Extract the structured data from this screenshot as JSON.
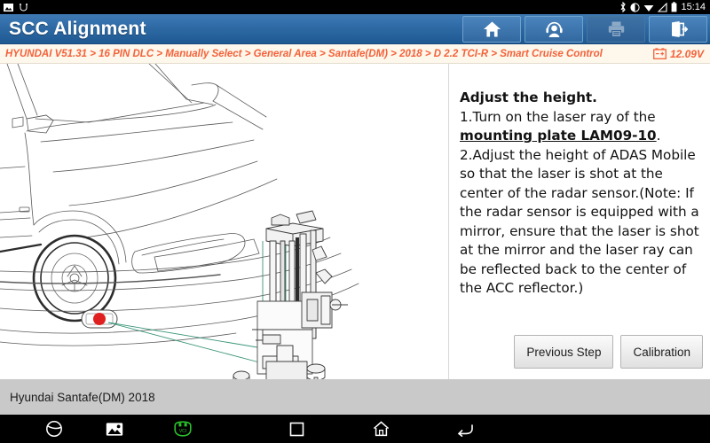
{
  "status_bar": {
    "clock": "15:14",
    "left_icons": [
      "screenshot-icon",
      "usb-debug-icon"
    ],
    "right_icons": [
      "bluetooth-icon",
      "do-not-disturb-icon",
      "wifi-icon",
      "signal-icon",
      "battery-icon"
    ]
  },
  "title_bar": {
    "title": "SCC Alignment",
    "buttons": [
      {
        "name": "home-button",
        "icon": "home-icon",
        "label": "Home",
        "enabled": true
      },
      {
        "name": "support-button",
        "icon": "headset-icon",
        "label": "Support",
        "enabled": true
      },
      {
        "name": "print-button",
        "icon": "printer-icon",
        "label": "Print",
        "enabled": false
      },
      {
        "name": "exit-button",
        "icon": "exit-icon",
        "label": "Exit",
        "enabled": true
      }
    ]
  },
  "path_bar": {
    "breadcrumb": "HYUNDAI V51.31 > 16 PIN DLC > Manually Select > General Area > Santafe(DM) > 2018 > D 2.2 TCI-R > Smart Cruise Control",
    "segments": [
      "HYUNDAI V51.31",
      "16 PIN DLC",
      "Manually Select",
      "General Area",
      "Santafe(DM)",
      "2018",
      "D 2.2 TCI-R",
      "Smart Cruise Control"
    ],
    "battery_icon": "car-battery-icon",
    "voltage": "12.09V"
  },
  "main": {
    "illustration": {
      "name": "adas-calibration-diagram",
      "description": "Line drawing of a vehicle front end with an ADAS Mobile calibration frame and laser aimed at the radar sensor",
      "radar_sensor_marker_color": "#e02020",
      "laser_ray_color": "#2f8f72"
    },
    "instruction": {
      "heading": "Adjust the height.",
      "step1_pre": "1.Turn on the laser ray of the ",
      "step1_emphasis": "mounting plate LAM09-10",
      "step1_post": ".",
      "step2": "2.Adjust the height of ADAS Mobile so that the laser is shot at the center of the radar sensor.(Note: If the radar sensor is equipped with a mirror, ensure that the laser is shot at the mirror and the laser ray can be reflected back to the center of the ACC reflector.)"
    },
    "buttons": {
      "previous": "Previous Step",
      "calibration": "Calibration"
    }
  },
  "info_bar": {
    "vehicle": "Hyundai Santafe(DM) 2018"
  },
  "nav_bar": {
    "items": [
      {
        "name": "browser-icon",
        "label": "Browser"
      },
      {
        "name": "gallery-icon",
        "label": "Gallery"
      },
      {
        "name": "vci-icon",
        "label": "VCI"
      },
      {
        "name": "recents-icon",
        "label": "Recents"
      },
      {
        "name": "home-nav-icon",
        "label": "Home"
      },
      {
        "name": "back-icon",
        "label": "Back"
      }
    ],
    "vci_color": "#2bbf2b"
  },
  "colors": {
    "header_blue": "#2f6ba6",
    "accent_orange": "#f4623a",
    "path_bg": "#fdf7ec",
    "info_bar_bg": "#c9c9c9"
  }
}
